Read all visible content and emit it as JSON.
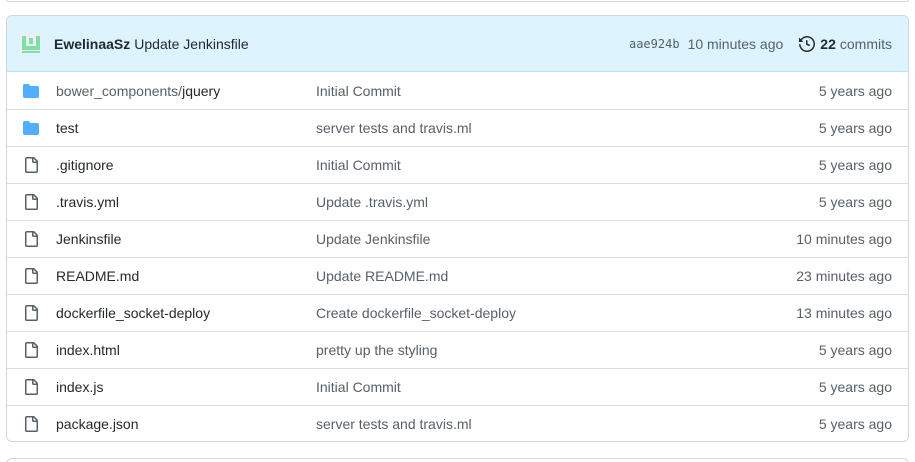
{
  "latest_commit": {
    "author": "EwelinaaSz",
    "message": "Update Jenkinsfile",
    "sha": "aae924b",
    "time": "10 minutes ago",
    "commit_count": "22",
    "commits_label": "commits"
  },
  "colors": {
    "header_bg": "#ddf4ff",
    "folder": "#54aeff",
    "file": "#57606a",
    "avatar": "#7fdfa6"
  },
  "files": [
    {
      "type": "folder",
      "icon": "folder-icon",
      "dir_prefix": "bower_components/",
      "name": "jquery",
      "message": "Initial Commit",
      "age": "5 years ago"
    },
    {
      "type": "folder",
      "icon": "folder-icon",
      "dir_prefix": "",
      "name": "test",
      "message": "server tests and travis.ml",
      "age": "5 years ago"
    },
    {
      "type": "file",
      "icon": "file-icon",
      "dir_prefix": "",
      "name": ".gitignore",
      "message": "Initial Commit",
      "age": "5 years ago"
    },
    {
      "type": "file",
      "icon": "file-icon",
      "dir_prefix": "",
      "name": ".travis.yml",
      "message": "Update .travis.yml",
      "age": "5 years ago"
    },
    {
      "type": "file",
      "icon": "file-icon",
      "dir_prefix": "",
      "name": "Jenkinsfile",
      "message": "Update Jenkinsfile",
      "age": "10 minutes ago"
    },
    {
      "type": "file",
      "icon": "file-icon",
      "dir_prefix": "",
      "name": "README.md",
      "message": "Update README.md",
      "age": "23 minutes ago"
    },
    {
      "type": "file",
      "icon": "file-icon",
      "dir_prefix": "",
      "name": "dockerfile_socket-deploy",
      "message": "Create dockerfile_socket-deploy",
      "age": "13 minutes ago"
    },
    {
      "type": "file",
      "icon": "file-icon",
      "dir_prefix": "",
      "name": "index.html",
      "message": "pretty up the styling",
      "age": "5 years ago"
    },
    {
      "type": "file",
      "icon": "file-icon",
      "dir_prefix": "",
      "name": "index.js",
      "message": "Initial Commit",
      "age": "5 years ago"
    },
    {
      "type": "file",
      "icon": "file-icon",
      "dir_prefix": "",
      "name": "package.json",
      "message": "server tests and travis.ml",
      "age": "5 years ago"
    }
  ]
}
